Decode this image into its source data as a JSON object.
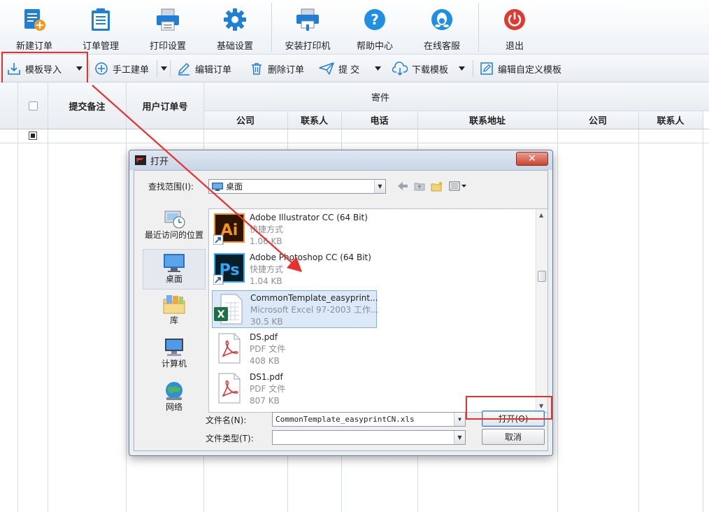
{
  "ribbon": {
    "items": [
      {
        "label": "新建订单",
        "icon": "new-order-icon"
      },
      {
        "label": "订单管理",
        "icon": "clipboard-icon"
      },
      {
        "label": "打印设置",
        "icon": "printer-icon"
      },
      {
        "label": "基础设置",
        "icon": "gear-icon"
      },
      {
        "label": "安装打印机",
        "icon": "install-printer-icon"
      },
      {
        "label": "帮助中心",
        "icon": "help-icon"
      },
      {
        "label": "在线客服",
        "icon": "customer-service-icon"
      },
      {
        "label": "退出",
        "icon": "power-icon"
      }
    ]
  },
  "toolbar": {
    "template_import": "模板导入",
    "manual_order": "手工建单",
    "edit_order": "编辑订单",
    "delete_order": "删除订单",
    "submit": "提 交",
    "download_template": "下载模板",
    "edit_custom_template": "编辑自定义模板"
  },
  "grid": {
    "headers": {
      "submit_note": "提交备注",
      "user_order_no": "用户订单号",
      "sender_group": "寄件",
      "sender_company": "公司",
      "sender_contact": "联系人",
      "sender_phone": "电话",
      "sender_address": "联系地址",
      "recv_company": "公司",
      "recv_contact": "联系人"
    }
  },
  "dialog": {
    "title": "打开",
    "look_in_label": "查找范围(I):",
    "look_in_value": "桌面",
    "places": [
      {
        "label": "最近访问的位置",
        "icon": "recent-places-icon"
      },
      {
        "label": "桌面",
        "icon": "desktop-icon"
      },
      {
        "label": "库",
        "icon": "libraries-icon"
      },
      {
        "label": "计算机",
        "icon": "computer-icon"
      },
      {
        "label": "网络",
        "icon": "network-icon"
      }
    ],
    "files": [
      {
        "name": "Adobe Illustrator CC (64 Bit)",
        "type": "快捷方式",
        "size": "1.06 KB",
        "icon": "illustrator-icon"
      },
      {
        "name": "Adobe Photoshop CC (64 Bit)",
        "type": "快捷方式",
        "size": "1.04 KB",
        "icon": "photoshop-icon"
      },
      {
        "name": "CommonTemplate_easyprint...",
        "type": "Microsoft Excel 97-2003 工作...",
        "size": "30.5 KB",
        "icon": "excel-file-icon"
      },
      {
        "name": "DS.pdf",
        "type": "PDF 文件",
        "size": "408 KB",
        "icon": "pdf-file-icon"
      },
      {
        "name": "DS1.pdf",
        "type": "PDF 文件",
        "size": "807 KB",
        "icon": "pdf-file-icon"
      }
    ],
    "filename_label": "文件名(N):",
    "filename_value": "CommonTemplate_easyprintCN.xls",
    "filetype_label": "文件类型(T):",
    "filetype_value": "",
    "open_button": "打开(O)",
    "cancel_button": "取消"
  },
  "colors": {
    "accent_blue": "#1f7fd6",
    "highlight_red": "#e8312f",
    "power_red": "#e03a2f"
  }
}
